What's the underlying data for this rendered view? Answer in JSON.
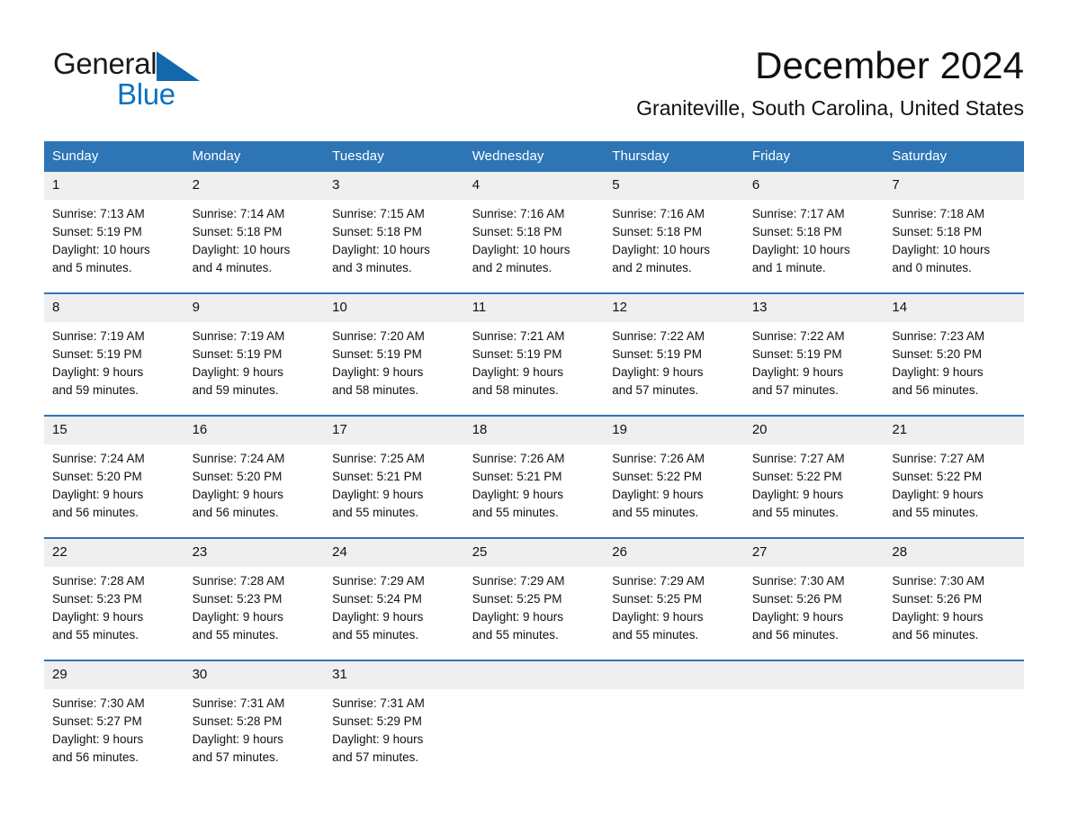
{
  "brand": {
    "word1": "General",
    "word2": "Blue",
    "triangle_color": "#1367ac",
    "word2_color": "#0e72c0"
  },
  "header": {
    "title": "December 2024",
    "subtitle": "Graniteville, South Carolina, United States"
  },
  "theme": {
    "header_blue": "#2e75b6",
    "daynum_gray": "#efefef",
    "text_color": "#111111"
  },
  "weekdays": [
    "Sunday",
    "Monday",
    "Tuesday",
    "Wednesday",
    "Thursday",
    "Friday",
    "Saturday"
  ],
  "weeks": [
    [
      {
        "day": "1",
        "sunrise": "Sunrise: 7:13 AM",
        "sunset": "Sunset: 5:19 PM",
        "daylight1": "Daylight: 10 hours",
        "daylight2": "and 5 minutes."
      },
      {
        "day": "2",
        "sunrise": "Sunrise: 7:14 AM",
        "sunset": "Sunset: 5:18 PM",
        "daylight1": "Daylight: 10 hours",
        "daylight2": "and 4 minutes."
      },
      {
        "day": "3",
        "sunrise": "Sunrise: 7:15 AM",
        "sunset": "Sunset: 5:18 PM",
        "daylight1": "Daylight: 10 hours",
        "daylight2": "and 3 minutes."
      },
      {
        "day": "4",
        "sunrise": "Sunrise: 7:16 AM",
        "sunset": "Sunset: 5:18 PM",
        "daylight1": "Daylight: 10 hours",
        "daylight2": "and 2 minutes."
      },
      {
        "day": "5",
        "sunrise": "Sunrise: 7:16 AM",
        "sunset": "Sunset: 5:18 PM",
        "daylight1": "Daylight: 10 hours",
        "daylight2": "and 2 minutes."
      },
      {
        "day": "6",
        "sunrise": "Sunrise: 7:17 AM",
        "sunset": "Sunset: 5:18 PM",
        "daylight1": "Daylight: 10 hours",
        "daylight2": "and 1 minute."
      },
      {
        "day": "7",
        "sunrise": "Sunrise: 7:18 AM",
        "sunset": "Sunset: 5:18 PM",
        "daylight1": "Daylight: 10 hours",
        "daylight2": "and 0 minutes."
      }
    ],
    [
      {
        "day": "8",
        "sunrise": "Sunrise: 7:19 AM",
        "sunset": "Sunset: 5:19 PM",
        "daylight1": "Daylight: 9 hours",
        "daylight2": "and 59 minutes."
      },
      {
        "day": "9",
        "sunrise": "Sunrise: 7:19 AM",
        "sunset": "Sunset: 5:19 PM",
        "daylight1": "Daylight: 9 hours",
        "daylight2": "and 59 minutes."
      },
      {
        "day": "10",
        "sunrise": "Sunrise: 7:20 AM",
        "sunset": "Sunset: 5:19 PM",
        "daylight1": "Daylight: 9 hours",
        "daylight2": "and 58 minutes."
      },
      {
        "day": "11",
        "sunrise": "Sunrise: 7:21 AM",
        "sunset": "Sunset: 5:19 PM",
        "daylight1": "Daylight: 9 hours",
        "daylight2": "and 58 minutes."
      },
      {
        "day": "12",
        "sunrise": "Sunrise: 7:22 AM",
        "sunset": "Sunset: 5:19 PM",
        "daylight1": "Daylight: 9 hours",
        "daylight2": "and 57 minutes."
      },
      {
        "day": "13",
        "sunrise": "Sunrise: 7:22 AM",
        "sunset": "Sunset: 5:19 PM",
        "daylight1": "Daylight: 9 hours",
        "daylight2": "and 57 minutes."
      },
      {
        "day": "14",
        "sunrise": "Sunrise: 7:23 AM",
        "sunset": "Sunset: 5:20 PM",
        "daylight1": "Daylight: 9 hours",
        "daylight2": "and 56 minutes."
      }
    ],
    [
      {
        "day": "15",
        "sunrise": "Sunrise: 7:24 AM",
        "sunset": "Sunset: 5:20 PM",
        "daylight1": "Daylight: 9 hours",
        "daylight2": "and 56 minutes."
      },
      {
        "day": "16",
        "sunrise": "Sunrise: 7:24 AM",
        "sunset": "Sunset: 5:20 PM",
        "daylight1": "Daylight: 9 hours",
        "daylight2": "and 56 minutes."
      },
      {
        "day": "17",
        "sunrise": "Sunrise: 7:25 AM",
        "sunset": "Sunset: 5:21 PM",
        "daylight1": "Daylight: 9 hours",
        "daylight2": "and 55 minutes."
      },
      {
        "day": "18",
        "sunrise": "Sunrise: 7:26 AM",
        "sunset": "Sunset: 5:21 PM",
        "daylight1": "Daylight: 9 hours",
        "daylight2": "and 55 minutes."
      },
      {
        "day": "19",
        "sunrise": "Sunrise: 7:26 AM",
        "sunset": "Sunset: 5:22 PM",
        "daylight1": "Daylight: 9 hours",
        "daylight2": "and 55 minutes."
      },
      {
        "day": "20",
        "sunrise": "Sunrise: 7:27 AM",
        "sunset": "Sunset: 5:22 PM",
        "daylight1": "Daylight: 9 hours",
        "daylight2": "and 55 minutes."
      },
      {
        "day": "21",
        "sunrise": "Sunrise: 7:27 AM",
        "sunset": "Sunset: 5:22 PM",
        "daylight1": "Daylight: 9 hours",
        "daylight2": "and 55 minutes."
      }
    ],
    [
      {
        "day": "22",
        "sunrise": "Sunrise: 7:28 AM",
        "sunset": "Sunset: 5:23 PM",
        "daylight1": "Daylight: 9 hours",
        "daylight2": "and 55 minutes."
      },
      {
        "day": "23",
        "sunrise": "Sunrise: 7:28 AM",
        "sunset": "Sunset: 5:23 PM",
        "daylight1": "Daylight: 9 hours",
        "daylight2": "and 55 minutes."
      },
      {
        "day": "24",
        "sunrise": "Sunrise: 7:29 AM",
        "sunset": "Sunset: 5:24 PM",
        "daylight1": "Daylight: 9 hours",
        "daylight2": "and 55 minutes."
      },
      {
        "day": "25",
        "sunrise": "Sunrise: 7:29 AM",
        "sunset": "Sunset: 5:25 PM",
        "daylight1": "Daylight: 9 hours",
        "daylight2": "and 55 minutes."
      },
      {
        "day": "26",
        "sunrise": "Sunrise: 7:29 AM",
        "sunset": "Sunset: 5:25 PM",
        "daylight1": "Daylight: 9 hours",
        "daylight2": "and 55 minutes."
      },
      {
        "day": "27",
        "sunrise": "Sunrise: 7:30 AM",
        "sunset": "Sunset: 5:26 PM",
        "daylight1": "Daylight: 9 hours",
        "daylight2": "and 56 minutes."
      },
      {
        "day": "28",
        "sunrise": "Sunrise: 7:30 AM",
        "sunset": "Sunset: 5:26 PM",
        "daylight1": "Daylight: 9 hours",
        "daylight2": "and 56 minutes."
      }
    ],
    [
      {
        "day": "29",
        "sunrise": "Sunrise: 7:30 AM",
        "sunset": "Sunset: 5:27 PM",
        "daylight1": "Daylight: 9 hours",
        "daylight2": "and 56 minutes."
      },
      {
        "day": "30",
        "sunrise": "Sunrise: 7:31 AM",
        "sunset": "Sunset: 5:28 PM",
        "daylight1": "Daylight: 9 hours",
        "daylight2": "and 57 minutes."
      },
      {
        "day": "31",
        "sunrise": "Sunrise: 7:31 AM",
        "sunset": "Sunset: 5:29 PM",
        "daylight1": "Daylight: 9 hours",
        "daylight2": "and 57 minutes."
      },
      {
        "day": "",
        "sunrise": "",
        "sunset": "",
        "daylight1": "",
        "daylight2": ""
      },
      {
        "day": "",
        "sunrise": "",
        "sunset": "",
        "daylight1": "",
        "daylight2": ""
      },
      {
        "day": "",
        "sunrise": "",
        "sunset": "",
        "daylight1": "",
        "daylight2": ""
      },
      {
        "day": "",
        "sunrise": "",
        "sunset": "",
        "daylight1": "",
        "daylight2": ""
      }
    ]
  ]
}
